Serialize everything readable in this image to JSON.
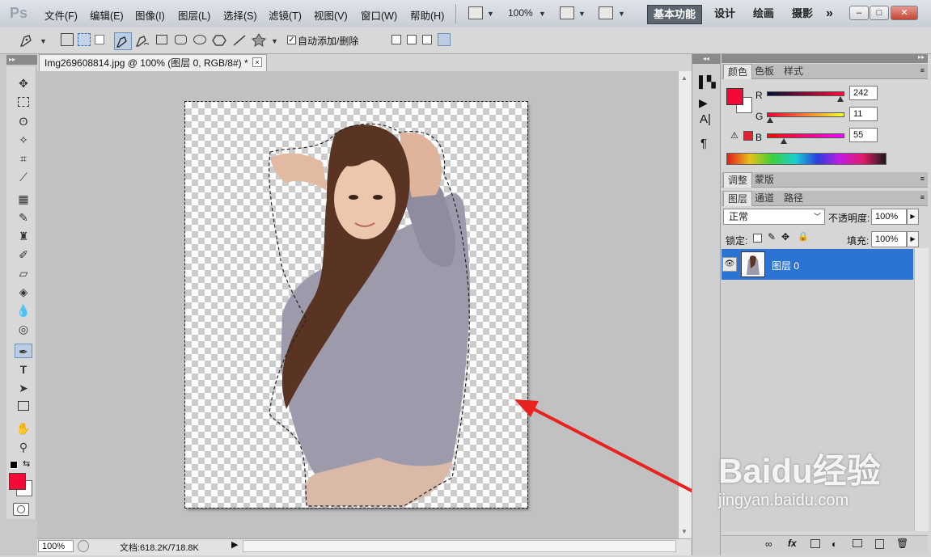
{
  "app": {
    "logo": "Ps"
  },
  "menu": {
    "items": [
      "文件(F)",
      "编辑(E)",
      "图像(I)",
      "图层(L)",
      "选择(S)",
      "滤镜(T)",
      "视图(V)",
      "窗口(W)",
      "帮助(H)"
    ]
  },
  "top_toolbar": {
    "zoom": "100%"
  },
  "workspaces": {
    "active": "基本功能",
    "items": [
      "基本功能",
      "设计",
      "绘画",
      "摄影"
    ],
    "more": "»"
  },
  "window_controls": {
    "minimize": "–",
    "restore": "□",
    "close": "✕"
  },
  "options": {
    "auto_add_delete_label": "自动添加/删除",
    "auto_add_delete_checked": true
  },
  "document": {
    "tab_title": "Img269608814.jpg @ 100% (图层 0, RGB/8#) *",
    "close_glyph": "×"
  },
  "status": {
    "zoom": "100%",
    "doc_size": "文档:618.2K/718.8K"
  },
  "color_panel": {
    "tabs": [
      "颜色",
      "色板",
      "样式"
    ],
    "r_label": "R",
    "g_label": "G",
    "b_label": "B",
    "r": "242",
    "g": "11",
    "b": "55",
    "r_fraction": 0.95,
    "g_fraction": 0.04,
    "b_fraction": 0.22,
    "foreground_color": "#f20b37",
    "background_color": "#ffffff"
  },
  "adjust_panel": {
    "tabs": [
      "调整",
      "蒙版"
    ]
  },
  "layers_panel": {
    "tabs": [
      "图层",
      "通道",
      "路径"
    ],
    "blend_mode": "正常",
    "opacity_label": "不透明度:",
    "opacity": "100%",
    "lock_label": "锁定:",
    "fill_label": "填充:",
    "fill": "100%",
    "layers": [
      {
        "name": "图层 0",
        "visible": true,
        "selected": true
      }
    ],
    "selected_color": "#2b74d3"
  },
  "watermark": {
    "brand": "Baidu经验",
    "url": "jingyan.baidu.com"
  },
  "colors": {
    "annotation_arrow": "#e8231f"
  }
}
